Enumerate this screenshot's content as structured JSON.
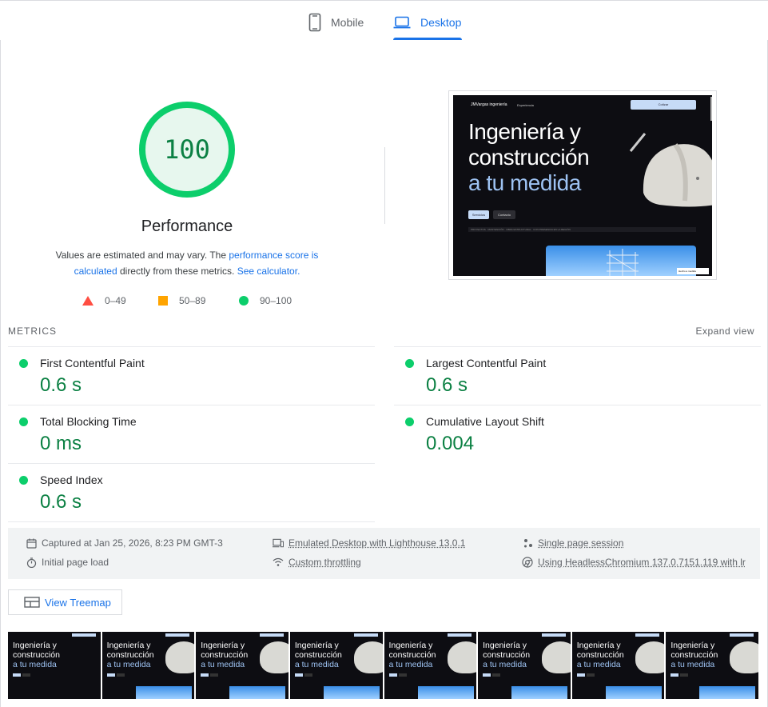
{
  "tabs": {
    "mobile_label": "Mobile",
    "desktop_label": "Desktop",
    "active": "Desktop"
  },
  "score": {
    "value": "100",
    "fraction": 1.0,
    "title": "Performance",
    "desc_prefix": "Values are estimated and may vary. The ",
    "desc_link1": "performance score is calculated",
    "desc_middle": " directly from these metrics. ",
    "desc_link2": "See calculator.",
    "color": "#0cce6b"
  },
  "legend": [
    {
      "range": "0–49",
      "color": "#ff4e42",
      "shape": "triangle"
    },
    {
      "range": "50–89",
      "color": "#ffa400",
      "shape": "square"
    },
    {
      "range": "90–100",
      "color": "#0cce6b",
      "shape": "circle"
    }
  ],
  "screenshot": {
    "logo": "JMVargas ingeniería",
    "nav": "Experiencia",
    "cta": "Cotizar",
    "headline_1": "Ingeniería y",
    "headline_2": "construcción",
    "headline_3": "a tu medida",
    "btn_services": "Servicios",
    "btn_contact": "Contacto",
    "strip": "PROYECTOS · MANTENCIÓN · OBRA ESTRUCTURAL · CON PRESENCIA EN LA REGIÓN",
    "badge": "Hecho a medida"
  },
  "metrics": {
    "section_label": "METRICS",
    "expand_label": "Expand view",
    "items": [
      {
        "name": "First Contentful Paint",
        "value": "0.6 s"
      },
      {
        "name": "Largest Contentful Paint",
        "value": "0.6 s"
      },
      {
        "name": "Total Blocking Time",
        "value": "0 ms"
      },
      {
        "name": "Cumulative Layout Shift",
        "value": "0.004"
      },
      {
        "name": "Speed Index",
        "value": "0.6 s"
      }
    ]
  },
  "info": {
    "captured": "Captured at Jan 25, 2026, 8:23 PM GMT-3",
    "load": "Initial page load",
    "emulated": "Emulated Desktop with Lighthouse 13.0.1",
    "throttling": "Custom throttling",
    "session": "Single page session",
    "browser": "Using HeadlessChromium 137.0.7151.119 with lr"
  },
  "treemap_label": "View Treemap",
  "filmstrip": {
    "frame_count": 8
  }
}
